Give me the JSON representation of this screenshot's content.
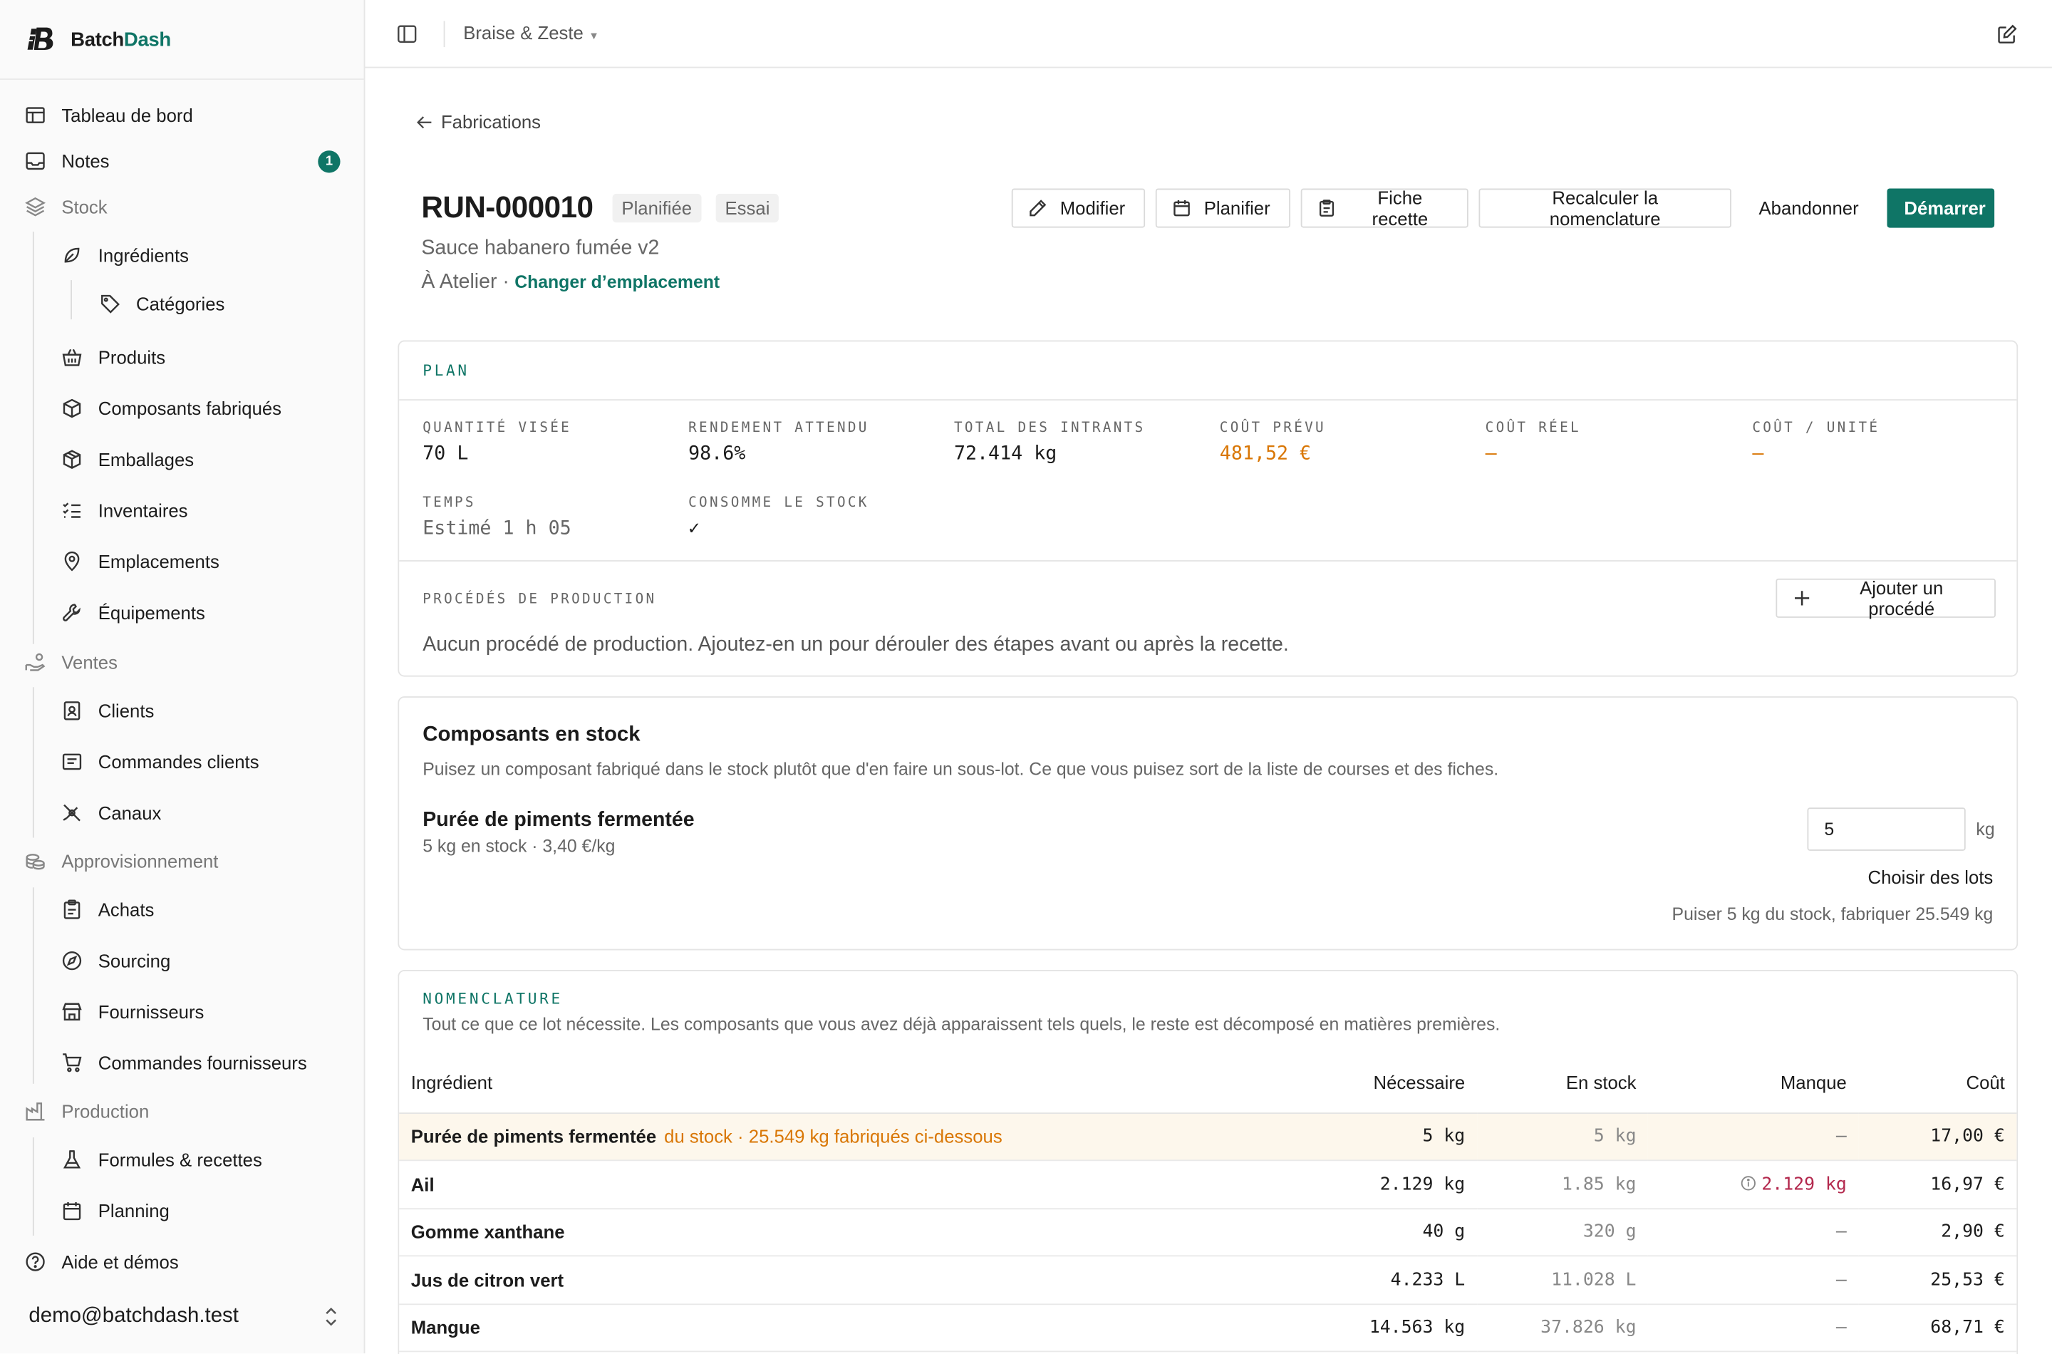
{
  "brand": {
    "name_part1": "Batch",
    "name_part2": "Dash"
  },
  "sidebar": {
    "items": [
      {
        "label": "Tableau de bord"
      },
      {
        "label": "Notes",
        "badge": "1"
      },
      {
        "label": "Stock"
      },
      {
        "label": "Ingrédients"
      },
      {
        "label": "Catégories"
      },
      {
        "label": "Produits"
      },
      {
        "label": "Composants fabriqués"
      },
      {
        "label": "Emballages"
      },
      {
        "label": "Inventaires"
      },
      {
        "label": "Emplacements"
      },
      {
        "label": "Équipements"
      },
      {
        "label": "Ventes"
      },
      {
        "label": "Clients"
      },
      {
        "label": "Commandes clients"
      },
      {
        "label": "Canaux"
      },
      {
        "label": "Approvisionnement"
      },
      {
        "label": "Achats"
      },
      {
        "label": "Sourcing"
      },
      {
        "label": "Fournisseurs"
      },
      {
        "label": "Commandes fournisseurs"
      },
      {
        "label": "Production"
      },
      {
        "label": "Formules & recettes"
      },
      {
        "label": "Planning"
      },
      {
        "label": "Aide et démos"
      }
    ],
    "user_email": "demo@batchdash.test"
  },
  "topbar": {
    "org_name": "Braise & Zeste"
  },
  "header": {
    "back_label": "Fabrications",
    "run_id": "RUN-000010",
    "status_tag": "Planifiée",
    "type_tag": "Essai",
    "product_name": "Sauce habanero fumée v2",
    "location_text": "À Atelier ·",
    "change_location": "Changer d’emplacement",
    "actions": {
      "modify": "Modifier",
      "schedule": "Planifier",
      "recipe_sheet": "Fiche recette",
      "recalc": "Recalculer la nomenclature",
      "abandon": "Abandonner",
      "start": "Démarrer"
    }
  },
  "plan": {
    "kicker": "PLAN",
    "stats": [
      {
        "label": "QUANTITÉ VISÉE",
        "value": "70 L"
      },
      {
        "label": "RENDEMENT ATTENDU",
        "value": "98.6%"
      },
      {
        "label": "TOTAL DES INTRANTS",
        "value": "72.414 kg"
      },
      {
        "label": "COÛT PRÉVU",
        "value": "481,52 €"
      },
      {
        "label": "COÛT RÉEL",
        "value": "—"
      },
      {
        "label": "COÛT / UNITÉ",
        "value": "—"
      },
      {
        "label": "TEMPS",
        "value": "Estimé 1 h 05"
      },
      {
        "label": "CONSOMME LE STOCK",
        "value": "✓"
      }
    ],
    "processes_label": "PROCÉDÉS DE PRODUCTION",
    "add_process": "Ajouter un procédé",
    "empty_text": "Aucun procédé de production. Ajoutez-en un pour dérouler des étapes avant ou après la recette."
  },
  "components": {
    "title": "Composants en stock",
    "description": "Puisez un composant fabriqué dans le stock plutôt que d'en faire un sous-lot. Ce que vous puisez sort de la liste de courses et des fiches.",
    "item_name": "Purée de piments fermentée",
    "item_meta": "5 kg en stock · 3,40 €/kg",
    "quantity_value": "5",
    "unit": "kg",
    "choose_lots": "Choisir des lots",
    "summary": "Puiser 5 kg du stock, fabriquer 25.549 kg"
  },
  "bom": {
    "kicker": "NOMENCLATURE",
    "description": "Tout ce que ce lot nécessite. Les composants que vous avez déjà apparaissent tels quels, le reste est décomposé en matières premières.",
    "columns": [
      "Ingrédient",
      "Nécessaire",
      "En stock",
      "Manque",
      "Coût"
    ],
    "rows": [
      {
        "name": "Purée de piments fermentée",
        "note": "du stock · 25.549 kg fabriqués ci-dessous",
        "needed": "5  kg",
        "stock": "5  kg",
        "short": "—",
        "cost": "17,00 €"
      },
      {
        "name": "Ail",
        "note": "",
        "needed": "2.129  kg",
        "stock": "1.85  kg",
        "short": "2.129  kg",
        "cost": "16,97 €"
      },
      {
        "name": "Gomme xanthane",
        "note": "",
        "needed": "40  g",
        "stock": "320  g",
        "short": "—",
        "cost": "2,90 €"
      },
      {
        "name": "Jus de citron vert",
        "note": "",
        "needed": "4.233  L",
        "stock": "11.028  L",
        "short": "—",
        "cost": "25,53 €"
      },
      {
        "name": "Mangue",
        "note": "",
        "needed": "14.563  kg",
        "stock": "37.826  kg",
        "short": "—",
        "cost": "68,71 €"
      }
    ]
  },
  "colors": {
    "accent": "#0f7566",
    "warning": "#d97706",
    "shortage": "#b3284d",
    "highlight_row": "#fdf7ec"
  }
}
